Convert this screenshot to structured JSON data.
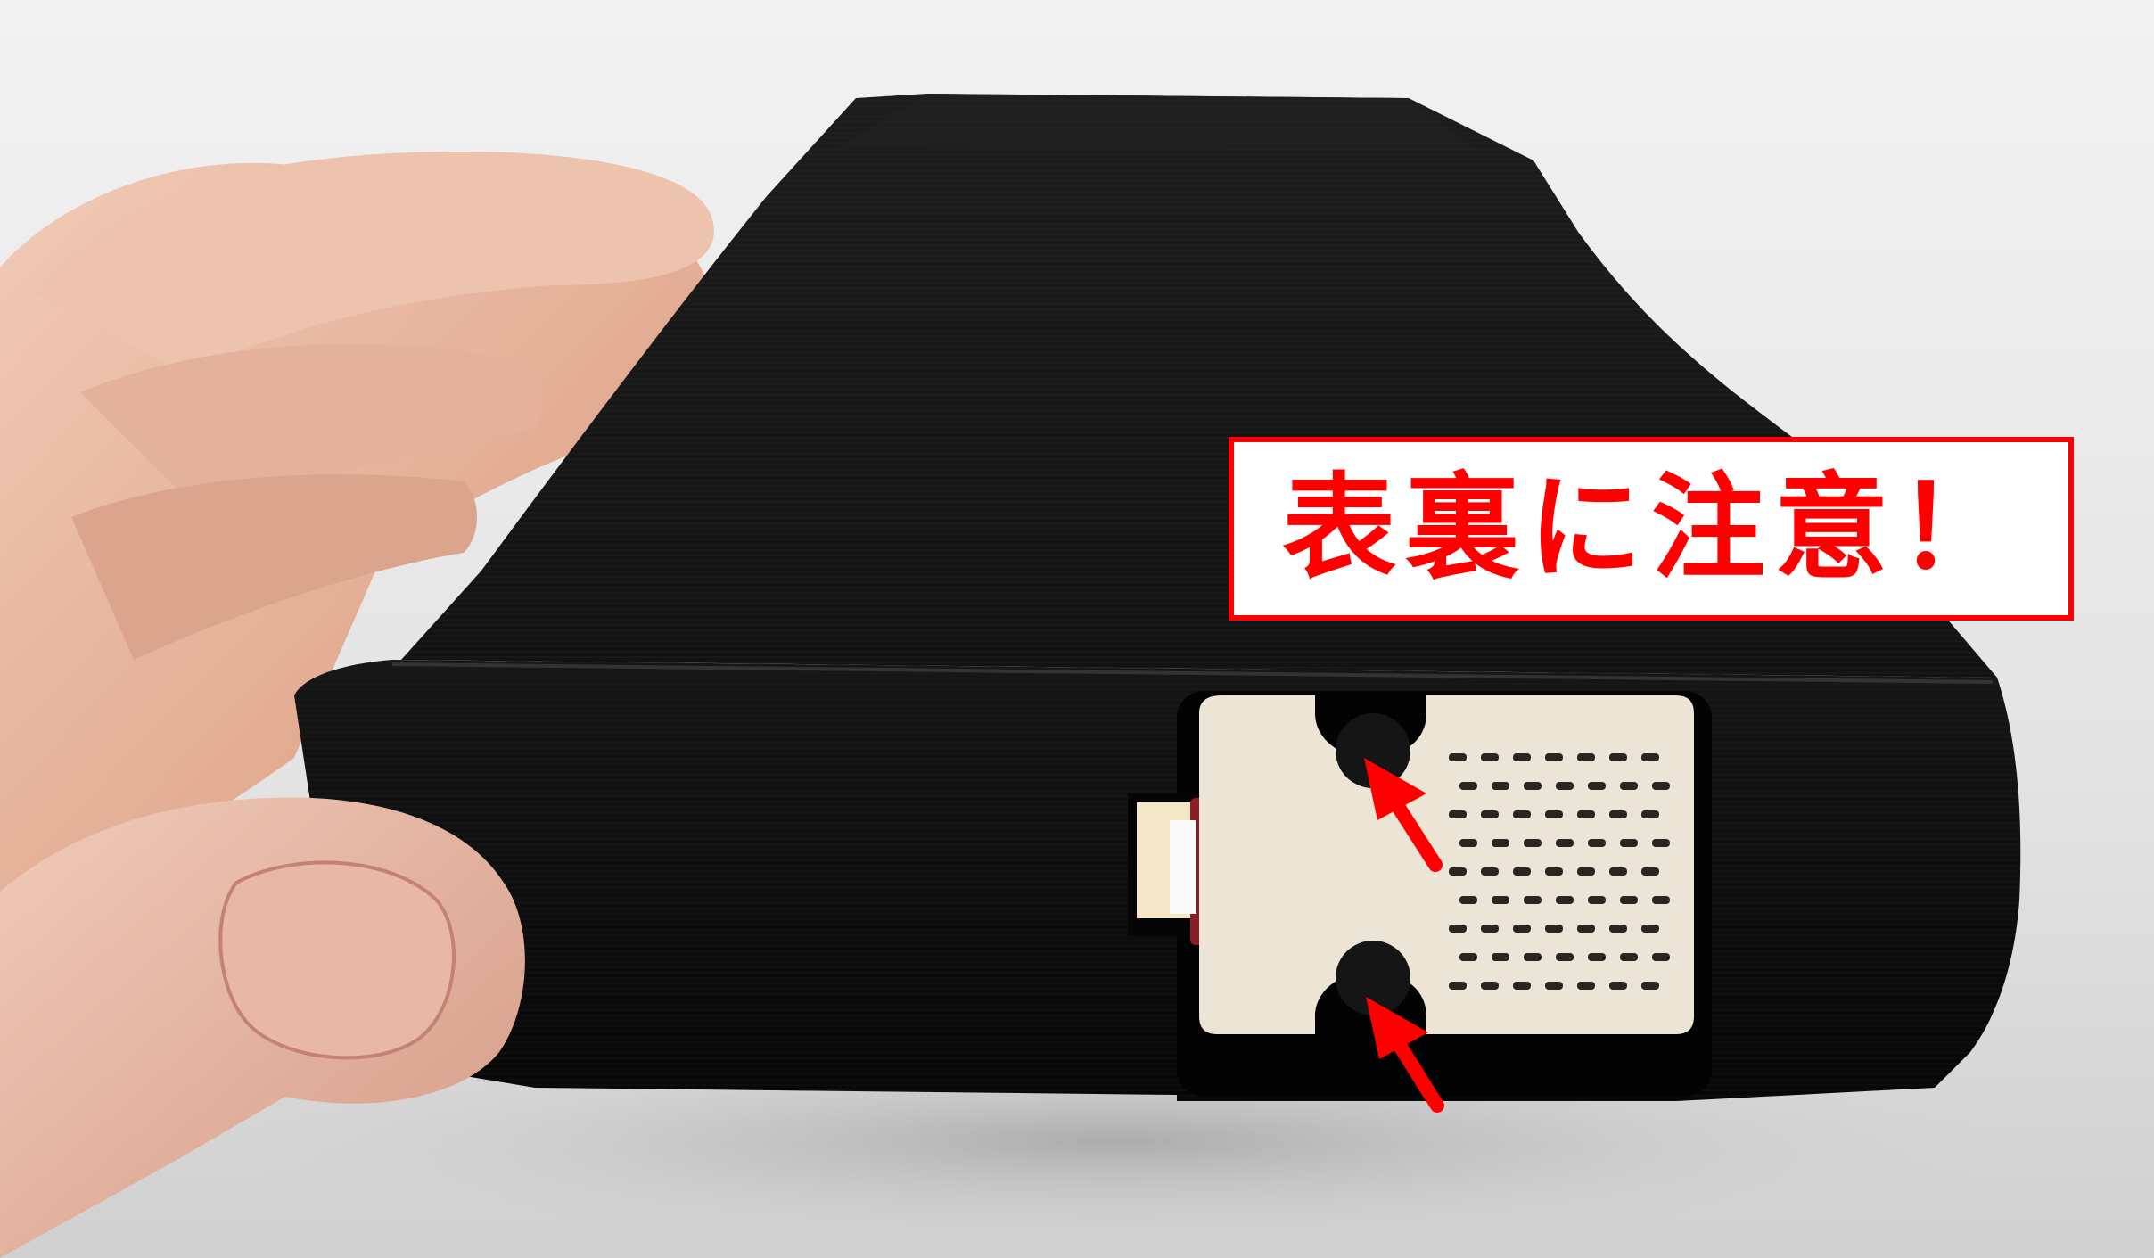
{
  "callout": {
    "text": "表裏に注意！",
    "color": "#ff0000"
  },
  "arrows": {
    "color": "#ff0000"
  },
  "case": {
    "color": "#0c0c0c"
  },
  "sensor": {
    "color": "#ece4d4"
  }
}
